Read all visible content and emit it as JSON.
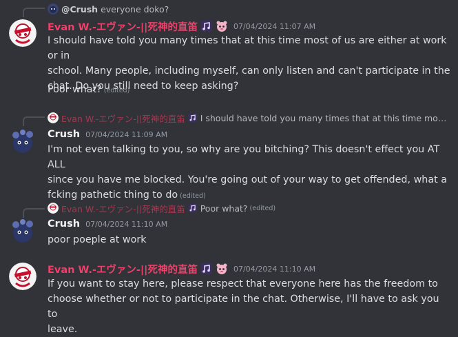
{
  "messages": [
    {
      "reply": {
        "author": "@Crush",
        "text": "everyone doko?"
      },
      "author": "Evan W.-エヴァン-||死神的直笛",
      "timestamp": "07/04/2024 11:07 AM",
      "lines": [
        "I should have told you many times that at this time most of us are either at work or in",
        "school. Many people, including myself, can only listen and can't participate in the",
        "chat. Do you still need to keep asking?"
      ],
      "followup": {
        "text": "Poor what?",
        "edited": "(edited)"
      }
    },
    {
      "reply": {
        "author": "Evan W.-エヴァン-||死神的直笛",
        "text": "I should have told you many times that at this time most ..."
      },
      "author": "Crush",
      "timestamp": "07/04/2024 11:09 AM",
      "lines": [
        "I'm not even talking to you, so why are you bitching? This doesn't effect you AT ALL",
        "since you have me blocked. You're going out of your way to get offended, what a",
        "fcking pathetic thing to do"
      ],
      "edited": "(edited)"
    },
    {
      "reply": {
        "author": "Evan W.-エヴァン-||死神的直笛",
        "text": "Poor what?",
        "edited": "(edited)"
      },
      "author": "Crush",
      "timestamp": "07/04/2024 11:10 AM",
      "lines": [
        "poor poeple at work"
      ]
    },
    {
      "author": "Evan W.-エヴァン-||死神的直笛",
      "timestamp": "07/04/2024 11:10 AM",
      "lines": [
        "If you want to stay here, please respect that everyone here has the freedom to",
        "choose whether or not to participate in the chat. Otherwise, I'll have to ask you to",
        "leave."
      ]
    }
  ],
  "colors": {
    "background": "#313338",
    "evan_name": "#f23f6a",
    "text": "#dbdee1",
    "timestamp": "#949ba4"
  },
  "icons": [
    "music-note-badge-icon",
    "pink-creature-badge-icon",
    "evan-avatar-icon",
    "crush-avatar-icon"
  ]
}
